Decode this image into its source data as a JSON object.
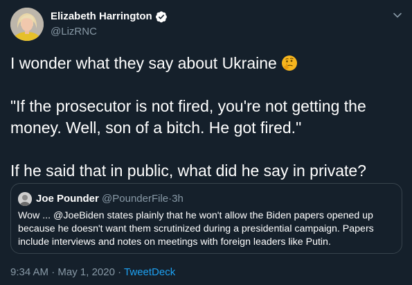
{
  "author": {
    "name": "Elizabeth Harrington",
    "handle": "@LizRNC",
    "verified": true
  },
  "tweet": {
    "line1": "I wonder what they say about Ukraine",
    "emoji": "thinking-face",
    "paragraph2": "\"If the prosecutor is not fired, you're not getting the money. Well, son of a bitch. He got fired.\"",
    "paragraph3": "If he said that in public, what did he say in private?"
  },
  "quoted_tweet": {
    "name": "Joe Pounder",
    "handle": "@PounderFile",
    "separator": "·",
    "time": "3h",
    "text": "Wow ... @JoeBiden states plainly that he won't allow the Biden papers opened up because he doesn't want them scrutinized during a presidential campaign. Papers include interviews and notes on meetings with foreign leaders like Putin."
  },
  "meta": {
    "time": "9:34 AM",
    "separator1": "·",
    "date": "May 1, 2020",
    "separator2": "·",
    "source": "TweetDeck"
  },
  "colors": {
    "background": "#15202b",
    "secondary_text": "#8899a6",
    "link": "#1da1f2",
    "border": "#38444d",
    "verified_badge": "#ffffff"
  },
  "icons": {
    "verified": "verified-badge-icon",
    "caret": "chevron-down-icon"
  }
}
